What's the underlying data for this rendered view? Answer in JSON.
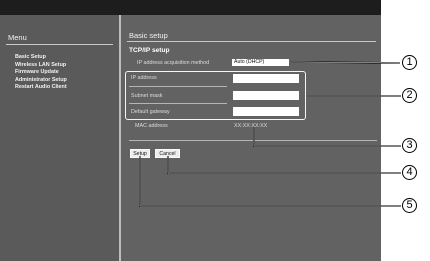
{
  "sidebar": {
    "title": "Menu",
    "items": [
      {
        "label": "Basic Setup"
      },
      {
        "label": "Wireless LAN Setup"
      },
      {
        "label": "Firmware Update"
      },
      {
        "label": "Administrator Setup"
      },
      {
        "label": "Restart Audio Client"
      }
    ]
  },
  "main": {
    "title": "Basic setup",
    "section_title": "TCP/IP setup",
    "ip_method_label": "IP address acquisition method",
    "ip_method_value": "Auto (DHCP)",
    "fields": [
      {
        "label": "IP address",
        "value": ""
      },
      {
        "label": "Subnet mask",
        "value": ""
      },
      {
        "label": "Default gateway",
        "value": ""
      }
    ],
    "mac_label": "MAC address",
    "mac_value": "XX:XX:XX:XX",
    "setup_button": "Setup",
    "cancel_button": "Cancel"
  },
  "callouts": [
    "1",
    "2",
    "3",
    "4",
    "5"
  ]
}
